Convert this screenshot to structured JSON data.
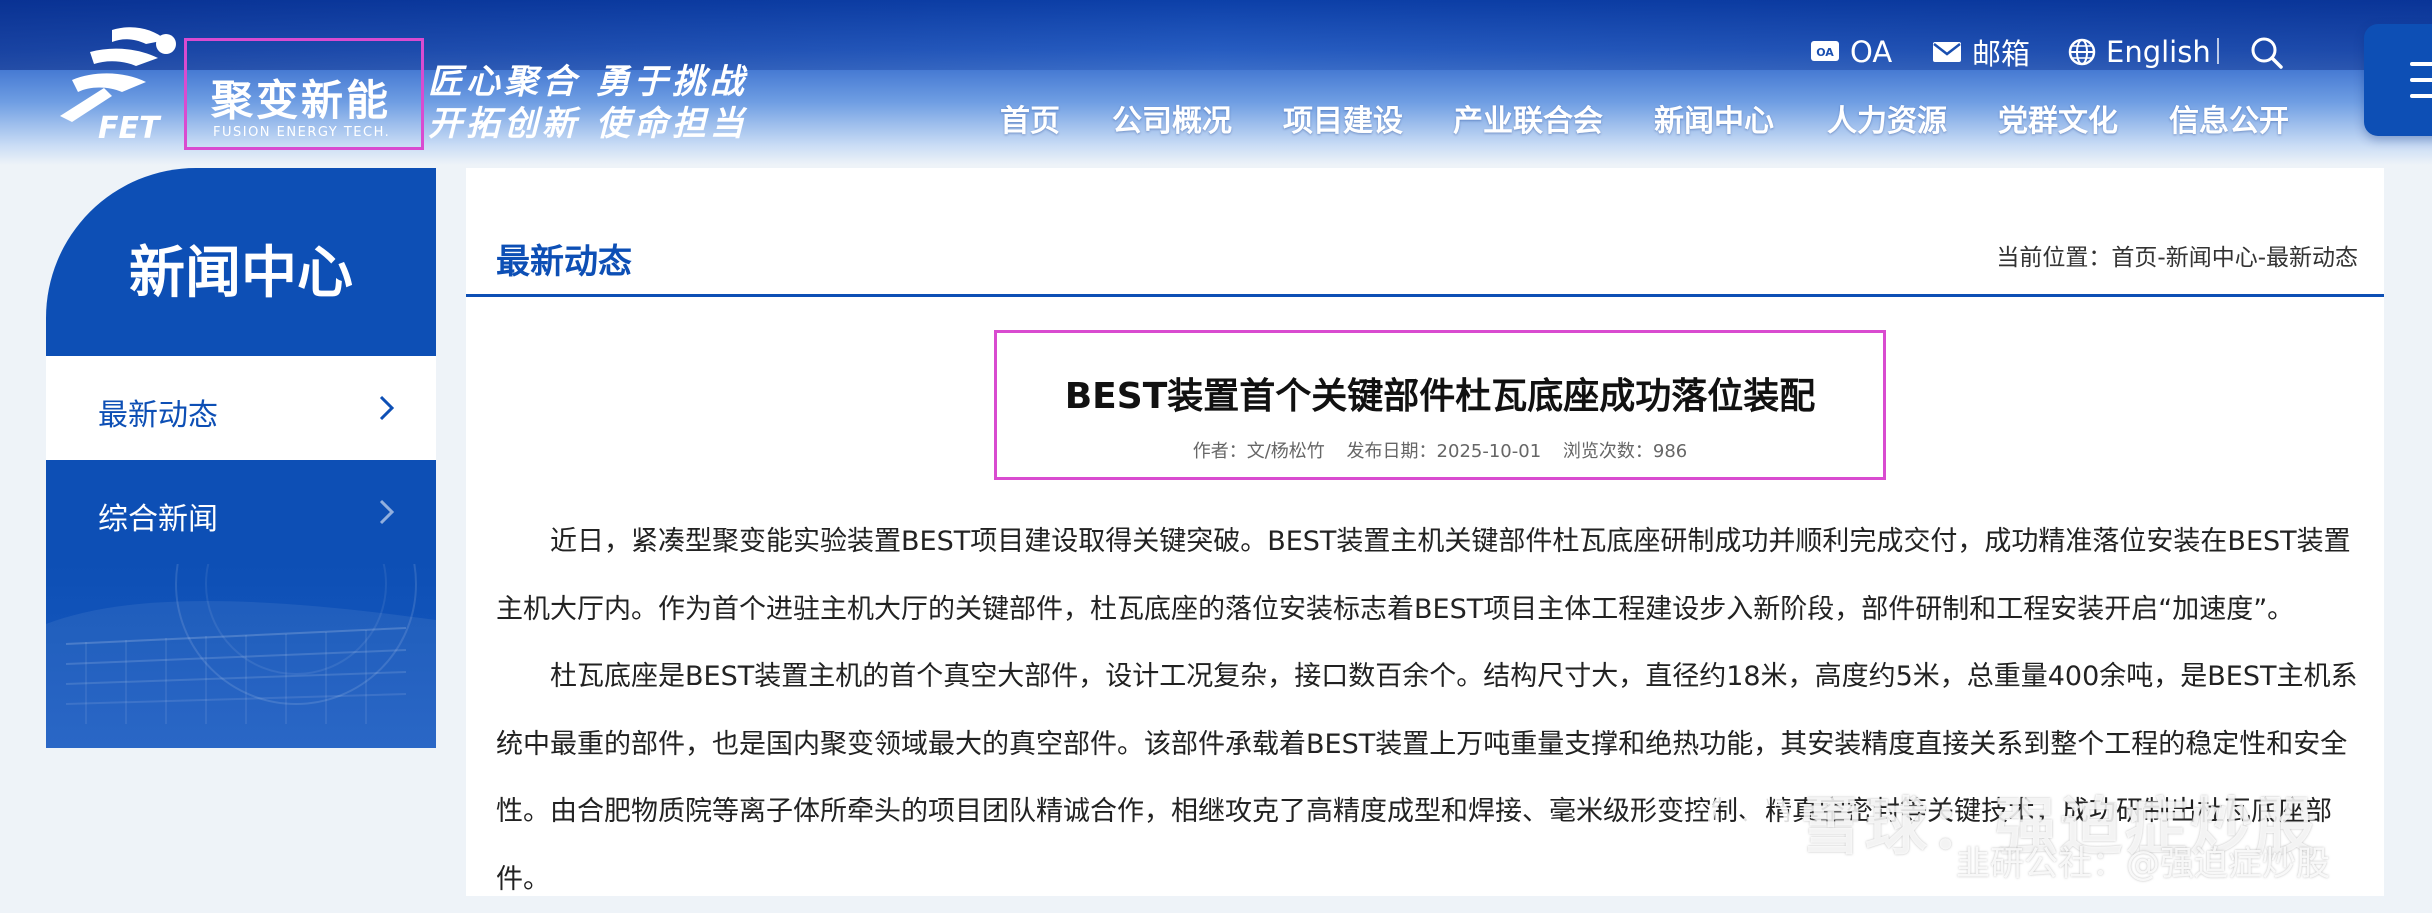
{
  "header": {
    "logo_cn": "聚变新能",
    "logo_en": "FUSION ENERGY TECH.",
    "slogan_line1": "匠心聚合 勇于挑战",
    "slogan_line2": "开拓创新 使命担当",
    "util": {
      "oa": "OA",
      "mail": "邮箱",
      "english": "English"
    },
    "nav": [
      "首页",
      "公司概况",
      "项目建设",
      "产业联合会",
      "新闻中心",
      "人力资源",
      "党群文化",
      "信息公开"
    ]
  },
  "sidebar": {
    "title": "新闻中心",
    "items": [
      {
        "label": "最新动态",
        "active": true
      },
      {
        "label": "综合新闻",
        "active": false
      }
    ]
  },
  "main": {
    "section_title": "最新动态",
    "breadcrumb": "当前位置：首页-新闻中心-最新动态",
    "article": {
      "title": "BEST装置首个关键部件杜瓦底座成功落位装配",
      "author": "作者：文/杨松竹",
      "date": "发布日期：2025-10-01",
      "views": "浏览次数：986",
      "paragraphs": [
        "近日，紧凑型聚变能实验装置BEST项目建设取得关键突破。BEST装置主机关键部件杜瓦底座研制成功并顺利完成交付，成功精准落位安装在BEST装置主机大厅内。作为首个进驻主机大厅的关键部件，杜瓦底座的落位安装标志着BEST项目主体工程建设步入新阶段，部件研制和工程安装开启“加速度”。",
        "杜瓦底座是BEST装置主机的首个真空大部件，设计工况复杂，接口数百余个。结构尺寸大，直径约18米，高度约5米，总重量400余吨，是BEST主机系统中最重的部件，也是国内聚变领域最大的真空部件。该部件承载着BEST装置上万吨重量支撑和绝热功能，其安装精度直接关系到整个工程的稳定性和安全性。由合肥物质院等离子体所牵头的项目团队精诚合作，相继攻克了高精度成型和焊接、毫米级形变控制、精真空密封等关键技术，成功研制出杜瓦底座部件。"
      ]
    }
  },
  "watermark": {
    "brand": "雪球：强迫症炒股",
    "sub": "韭研公社：@强迫症炒股"
  },
  "colors": {
    "primary": "#0d4fb5",
    "highlight_box": "#d94bd0"
  }
}
